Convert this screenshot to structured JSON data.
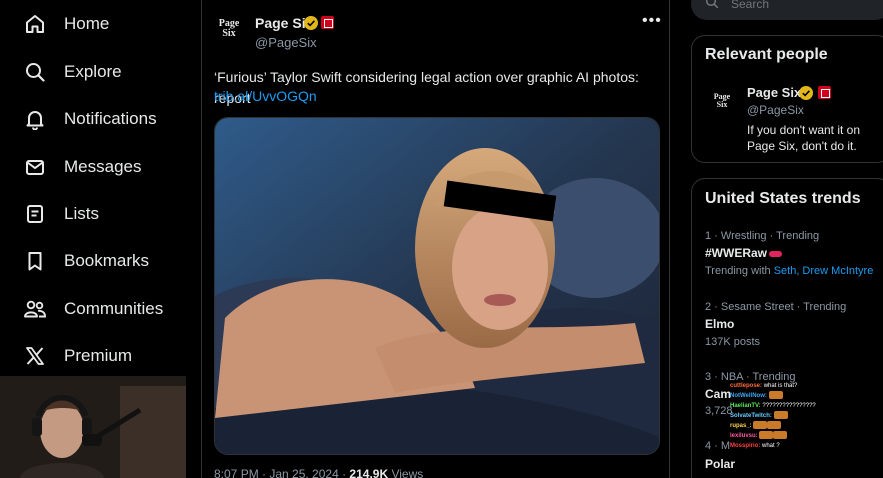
{
  "nav": {
    "items": [
      {
        "label": "Home",
        "icon": "home-icon"
      },
      {
        "label": "Explore",
        "icon": "search-icon"
      },
      {
        "label": "Notifications",
        "icon": "bell-icon"
      },
      {
        "label": "Messages",
        "icon": "envelope-icon"
      },
      {
        "label": "Lists",
        "icon": "list-icon"
      },
      {
        "label": "Bookmarks",
        "icon": "bookmark-icon"
      },
      {
        "label": "Communities",
        "icon": "people-icon"
      },
      {
        "label": "Premium",
        "icon": "x-logo-icon"
      }
    ]
  },
  "tweet": {
    "author_logo": "Page Six",
    "author_name": "Page Six",
    "handle": "@PageSix",
    "text": "‘Furious’ Taylor Swift considering legal action over graphic AI photos: report",
    "link": "trib.al/UvvOGQn",
    "time": "8:07 PM · Jan 25, 2024 · ",
    "views": "214.9K",
    "views_label": " Views"
  },
  "search": {
    "placeholder": "Search"
  },
  "relevant_people": {
    "title": "Relevant people",
    "name": "Page Six",
    "handle": "@PageSix",
    "bio": "If you don't want it on Page Six, don't do it."
  },
  "trends": {
    "title": "United States trends",
    "items": [
      {
        "meta": "1 · Wrestling · Trending",
        "name": "#WWERaw",
        "extra_prefix": "Trending with ",
        "extra_links": "Seth, Drew McIntyre"
      },
      {
        "meta": "2 · Sesame Street · Trending",
        "name": "Elmo",
        "extra": "137K posts"
      },
      {
        "meta": "3 · NBA · Trending",
        "name": "Cam",
        "extra": "3,728"
      },
      {
        "meta": "4 · M",
        "name": "Polar"
      }
    ]
  },
  "chat": {
    "lines": [
      {
        "user": "cuttlepose:",
        "msg": "what is that?",
        "color": "#ff6a3d"
      },
      {
        "user": "NotWellNow:",
        "msg": "",
        "color": "#3fa9f5"
      },
      {
        "user": "HaelianTV:",
        "msg": "????????????????",
        "color": "#5ce65c"
      },
      {
        "user": "SolvateTwitch:",
        "msg": "",
        "color": "#66ccff"
      },
      {
        "user": "rupas_:",
        "msg": "",
        "color": "#ffd24a"
      },
      {
        "user": "lexiluvsu:",
        "msg": "",
        "color": "#ff5c9e"
      },
      {
        "user": "Mosspirio:",
        "msg": "what ?",
        "color": "#ff4040"
      }
    ]
  },
  "colors": {
    "accent": "#1d9bf0",
    "verified_gold": "#e2b719",
    "background": "#000000"
  }
}
